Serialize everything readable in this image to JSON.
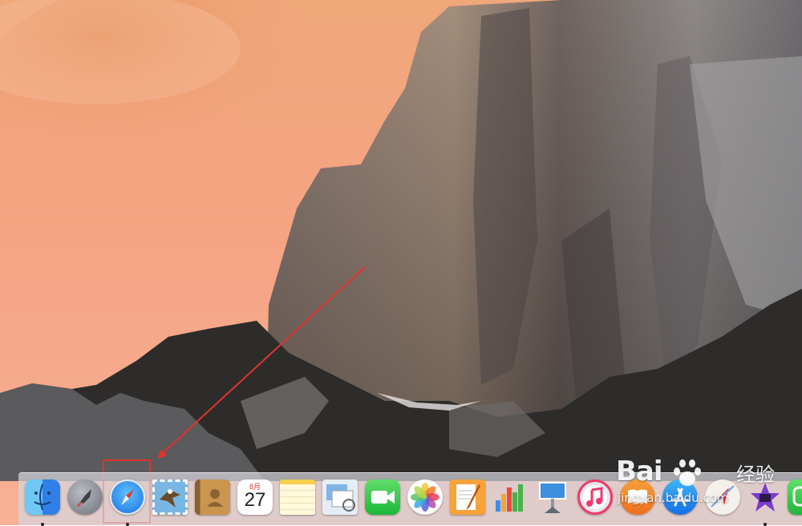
{
  "screen": {
    "type": "desktop",
    "wallpaper": "yosemite-el-capitan-sunset"
  },
  "annotation": {
    "color": "#e0342d",
    "target": "safari"
  },
  "calendar": {
    "month": "8月",
    "day": "27"
  },
  "dock": {
    "items": [
      {
        "name": "finder",
        "icon": "finder-icon",
        "running": true
      },
      {
        "name": "launchpad",
        "icon": "rocket-icon",
        "running": false
      },
      {
        "name": "safari",
        "icon": "compass-icon",
        "running": true
      },
      {
        "name": "mail",
        "icon": "eagle-stamp-icon",
        "running": false
      },
      {
        "name": "contacts",
        "icon": "address-book-icon",
        "running": false
      },
      {
        "name": "calendar",
        "icon": "calendar-icon",
        "running": false
      },
      {
        "name": "notes",
        "icon": "notepad-icon",
        "running": false
      },
      {
        "name": "preview",
        "icon": "photos-preview-icon",
        "running": false
      },
      {
        "name": "facetime",
        "icon": "video-camera-icon",
        "running": false
      },
      {
        "name": "photos",
        "icon": "flower-icon",
        "running": false
      },
      {
        "name": "pages",
        "icon": "pen-paper-icon",
        "running": false
      },
      {
        "name": "numbers",
        "icon": "bar-chart-icon",
        "running": false
      },
      {
        "name": "keynote",
        "icon": "podium-icon",
        "running": false
      },
      {
        "name": "itunes",
        "icon": "music-note-icon",
        "running": false
      },
      {
        "name": "ibooks",
        "icon": "book-icon",
        "running": false
      },
      {
        "name": "app-store",
        "icon": "app-store-icon",
        "running": false
      },
      {
        "name": "maps",
        "icon": "location-arrow-icon",
        "running": false
      },
      {
        "name": "imovie",
        "icon": "star-film-icon",
        "running": true
      },
      {
        "name": "messages",
        "icon": "chat-bubble-icon",
        "running": false
      }
    ]
  },
  "watermark": {
    "brand": "Bai",
    "brand_suffix": "经验",
    "url": "jingyan.baidu.com"
  }
}
